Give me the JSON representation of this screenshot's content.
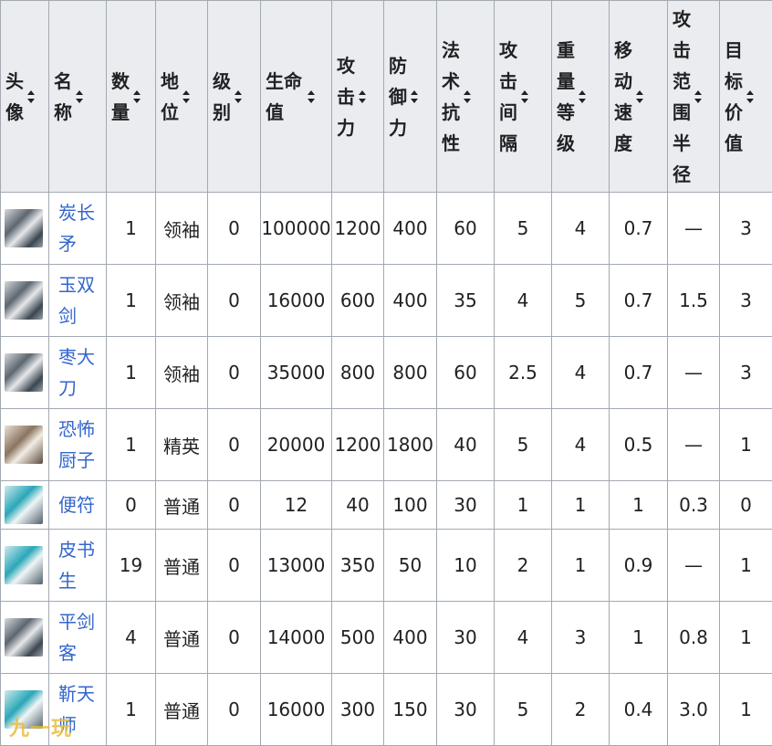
{
  "table": {
    "headers": [
      "头像",
      "名称",
      "数量",
      "地位",
      "级别",
      "生命值",
      "攻击力",
      "防御力",
      "法术抗性",
      "攻击间隔",
      "重量等级",
      "移动速度",
      "攻击范围半径",
      "目标价值"
    ],
    "rows": [
      {
        "name": "炭长矛",
        "count": "1",
        "rank": "领袖",
        "level": "0",
        "hp": "100000",
        "atk": "1200",
        "def": "400",
        "res": "60",
        "interval": "5",
        "weight": "4",
        "speed": "0.7",
        "range": "—",
        "target": "3"
      },
      {
        "name": "玉双剑",
        "count": "1",
        "rank": "领袖",
        "level": "0",
        "hp": "16000",
        "atk": "600",
        "def": "400",
        "res": "35",
        "interval": "4",
        "weight": "5",
        "speed": "0.7",
        "range": "1.5",
        "target": "3"
      },
      {
        "name": "枣大刀",
        "count": "1",
        "rank": "领袖",
        "level": "0",
        "hp": "35000",
        "atk": "800",
        "def": "800",
        "res": "60",
        "interval": "2.5",
        "weight": "4",
        "speed": "0.7",
        "range": "—",
        "target": "3"
      },
      {
        "name": "恐怖厨子",
        "count": "1",
        "rank": "精英",
        "level": "0",
        "hp": "20000",
        "atk": "1200",
        "def": "1800",
        "res": "40",
        "interval": "5",
        "weight": "4",
        "speed": "0.5",
        "range": "—",
        "target": "1"
      },
      {
        "name": "便符",
        "count": "0",
        "rank": "普通",
        "level": "0",
        "hp": "12",
        "atk": "40",
        "def": "100",
        "res": "30",
        "interval": "1",
        "weight": "1",
        "speed": "1",
        "range": "0.3",
        "target": "0"
      },
      {
        "name": "皮书生",
        "count": "19",
        "rank": "普通",
        "level": "0",
        "hp": "13000",
        "atk": "350",
        "def": "50",
        "res": "10",
        "interval": "2",
        "weight": "1",
        "speed": "0.9",
        "range": "—",
        "target": "1"
      },
      {
        "name": "平剑客",
        "count": "4",
        "rank": "普通",
        "level": "0",
        "hp": "14000",
        "atk": "500",
        "def": "400",
        "res": "30",
        "interval": "4",
        "weight": "3",
        "speed": "1",
        "range": "0.8",
        "target": "1"
      },
      {
        "name": "靳天师",
        "count": "1",
        "rank": "普通",
        "level": "0",
        "hp": "16000",
        "atk": "300",
        "def": "150",
        "res": "30",
        "interval": "5",
        "weight": "2",
        "speed": "0.4",
        "range": "3.0",
        "target": "1"
      }
    ]
  },
  "watermark": "九一玩"
}
